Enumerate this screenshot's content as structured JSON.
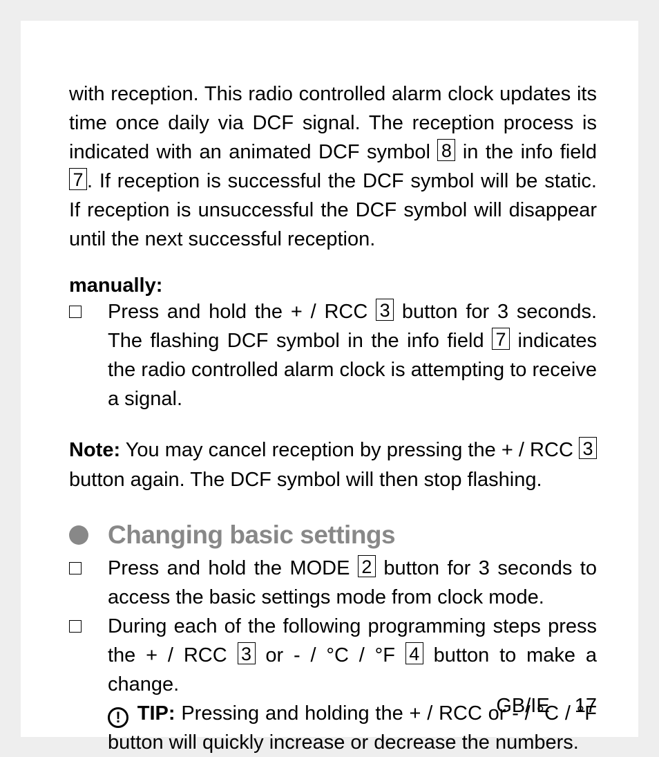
{
  "intro_para": {
    "p1a": "with reception. This radio controlled alarm clock updates its time once daily via DCF signal. The reception process is indi­cated with an animated DCF symbol ",
    "box1": "8",
    "p1b": " in the info field ",
    "box2": "7",
    "p1c": ". If reception is successful the DCF symbol will be static. If re­ception is unsuccessful the DCF symbol will disappear until the next successful reception."
  },
  "manual": {
    "heading": "manually:",
    "item1a": "Press and hold the + / RCC ",
    "item1_box1": "3",
    "item1b": " button for 3 seconds. The flashing DCF symbol in the info field ",
    "item1_box2": "7",
    "item1c": " indicates the radio controlled alarm clock is attempting to receive a signal."
  },
  "note": {
    "label": "Note:",
    "text_a": " You may cancel reception by pressing the + / RCC ",
    "box": "3",
    "text_b": " button again. The DCF symbol will then stop flashing."
  },
  "section": {
    "heading": "Changing basic settings",
    "item1a": "Press and hold the MODE ",
    "item1_box": "2",
    "item1b": " button for 3 seconds to access the basic settings mode from clock mode.",
    "item2a": "During each of the following programming steps press the + / RCC ",
    "item2_box1": "3",
    "item2b": " or - / °C / °F ",
    "item2_box2": "4",
    "item2c": " button to make a change.",
    "tip_label": "TIP:",
    "tip_text": " Pressing and holding the + / RCC or - / °C / °F button will quickly increase or decrease the numbers."
  },
  "footer": {
    "region": "GB/IE",
    "page": "17"
  },
  "icons": {
    "exclaim": "!"
  }
}
